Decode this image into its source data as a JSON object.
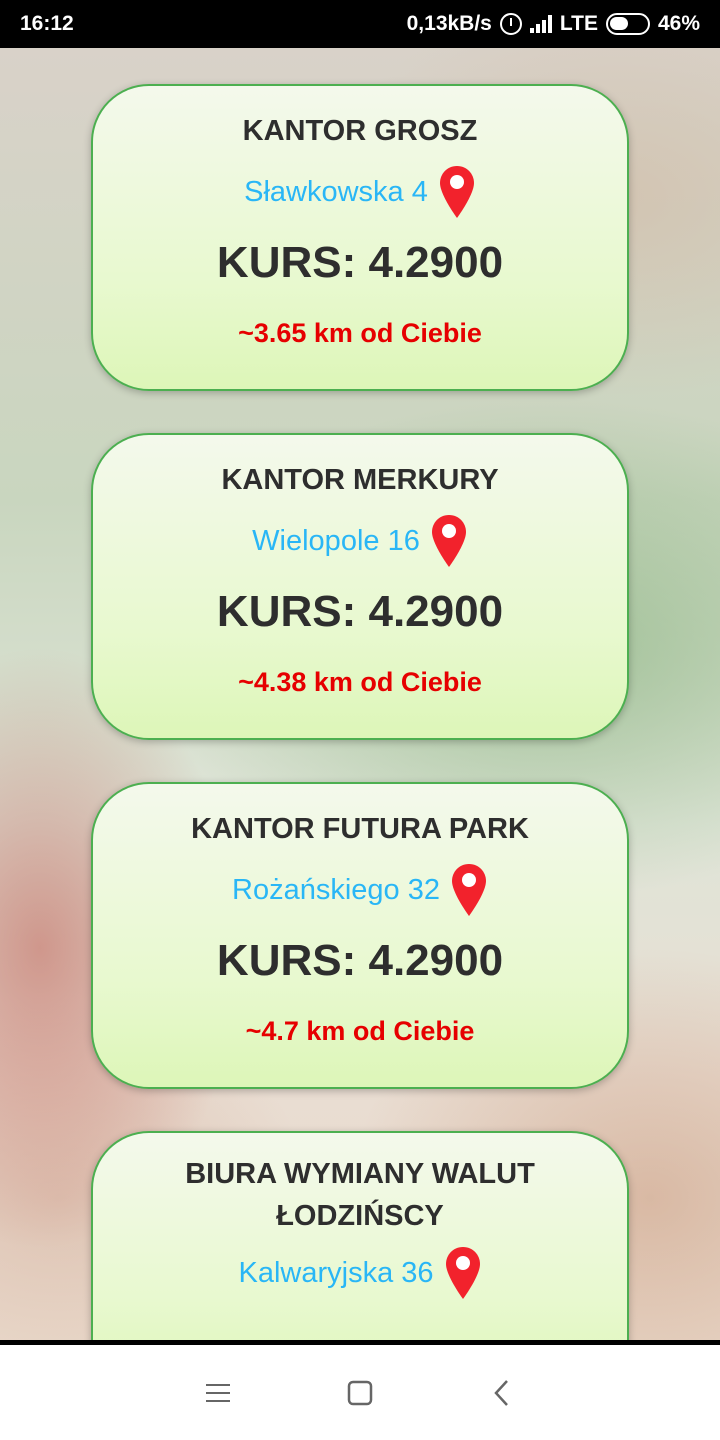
{
  "status_bar": {
    "time": "16:12",
    "speed": "0,13kB/s",
    "network": "LTE",
    "battery": "46%"
  },
  "colors": {
    "card_border": "#4caf50",
    "address": "#29b6f6",
    "distance": "#e60000",
    "pin": "#f2222c"
  },
  "cards": [
    {
      "name": "KANTOR GROSZ",
      "address": "Sławkowska 4",
      "rate": "KURS: 4.2900",
      "distance": "~3.65 km od Ciebie"
    },
    {
      "name": "KANTOR MERKURY",
      "address": "Wielopole 16",
      "rate": "KURS: 4.2900",
      "distance": "~4.38 km od Ciebie"
    },
    {
      "name": "KANTOR FUTURA PARK",
      "address": "Rożańskiego 32",
      "rate": "KURS: 4.2900",
      "distance": "~4.7 km od Ciebie"
    },
    {
      "name": "BIURA WYMIANY WALUT ŁODZIŃSCY",
      "address": "Kalwaryjska 36"
    }
  ],
  "nav_bar": {
    "icons": [
      "menu-icon",
      "home-square-icon",
      "back-chevron-icon"
    ]
  }
}
